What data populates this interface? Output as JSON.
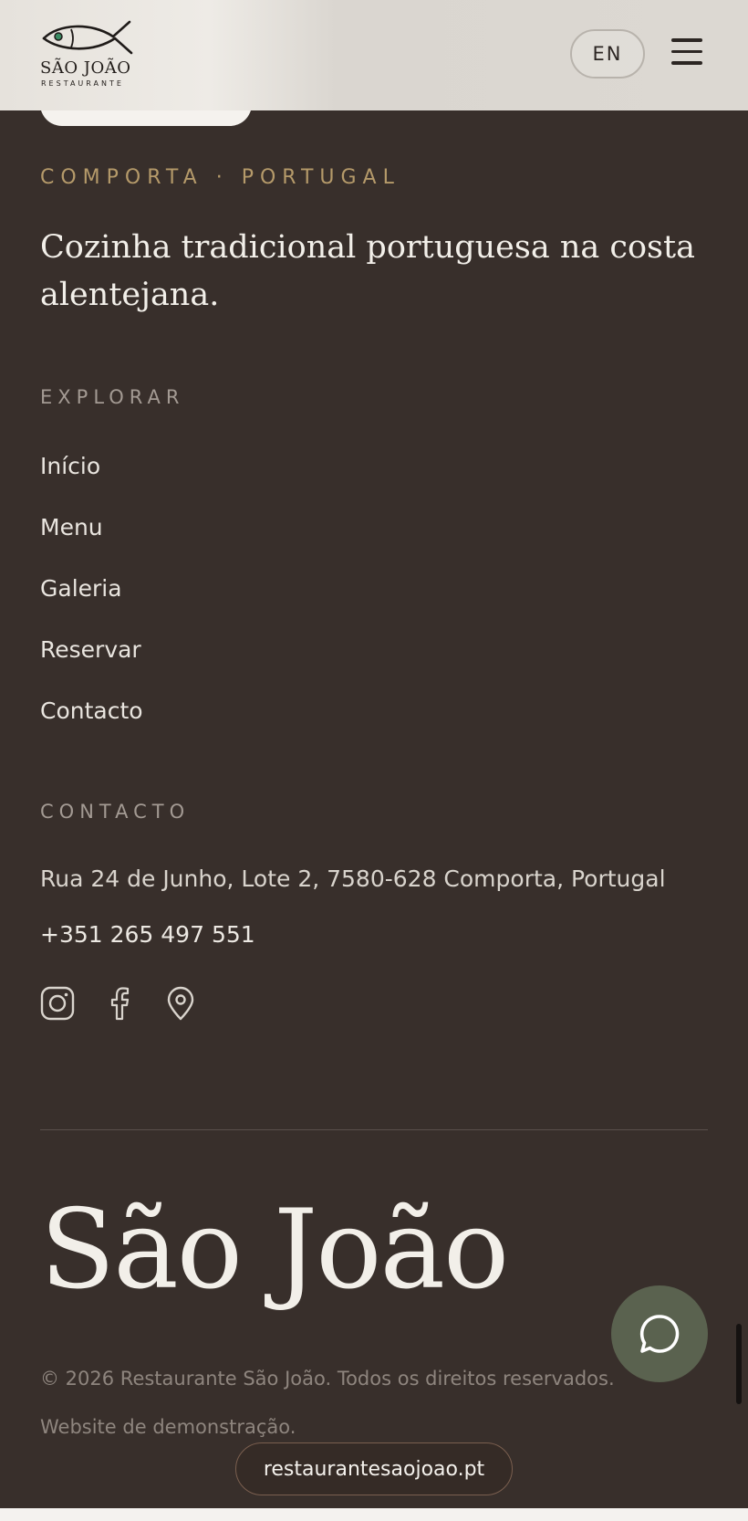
{
  "header": {
    "logo_name": "SÃO JOÃO",
    "logo_sub": "RESTAURANTE",
    "lang_label": "EN",
    "menu_icon": "hamburger-icon"
  },
  "intro": {
    "kicker": "COMPORTA · PORTUGAL",
    "tagline": "Cozinha tradicional portuguesa na costa alentejana."
  },
  "explore": {
    "label": "EXPLORAR",
    "links": [
      "Início",
      "Menu",
      "Galeria",
      "Reservar",
      "Contacto"
    ]
  },
  "contact": {
    "label": "CONTACTO",
    "address": "Rua 24 de Junho, Lote 2, 7580-628 Comporta, Portugal",
    "phone": "+351 265 497 551",
    "social_icons": [
      "instagram-icon",
      "facebook-icon",
      "map-pin-icon"
    ]
  },
  "footer": {
    "big_name": "São João",
    "copyright": "© 2026 Restaurante São João. Todos os direitos reservados.",
    "demo_note": "Website de demonstração.",
    "url": "restaurantesaojoao.pt",
    "chat_icon": "chat-bubble-icon"
  },
  "colors": {
    "background": "#382f2b",
    "accent_gold": "#b59a6a",
    "chat_button": "#5a624f"
  }
}
